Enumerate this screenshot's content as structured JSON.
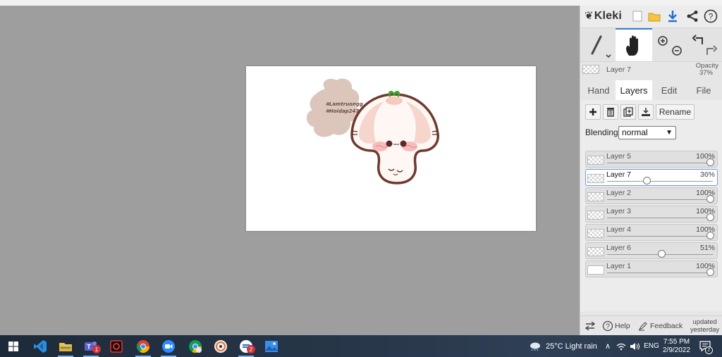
{
  "app": {
    "name": "Kleki"
  },
  "canvas": {
    "hashtags": [
      "#Lamtruongg",
      "#Hoidap247"
    ]
  },
  "current_layer": {
    "name": "Layer 7",
    "opacity_label": "Opacity",
    "opacity_value": "37%"
  },
  "tabs": [
    {
      "label": "Hand",
      "selected": false
    },
    {
      "label": "Layers",
      "selected": true
    },
    {
      "label": "Edit",
      "selected": false
    },
    {
      "label": "File",
      "selected": false
    }
  ],
  "layer_panel": {
    "add_icon": "plus-icon",
    "delete_icon": "trash-icon",
    "duplicate_icon": "duplicate-icon",
    "merge_icon": "merge-down-icon",
    "rename_label": "Rename",
    "blending_label": "Blending",
    "blending_value": "normal"
  },
  "layers": [
    {
      "name": "Layer 5",
      "opacity": "100%",
      "opacity_fraction": 1.0,
      "selected": false
    },
    {
      "name": "Layer 7",
      "opacity": "36%",
      "opacity_fraction": 0.36,
      "selected": true
    },
    {
      "name": "Layer 2",
      "opacity": "100%",
      "opacity_fraction": 1.0,
      "selected": false
    },
    {
      "name": "Layer 3",
      "opacity": "100%",
      "opacity_fraction": 1.0,
      "selected": false
    },
    {
      "name": "Layer 4",
      "opacity": "100%",
      "opacity_fraction": 1.0,
      "selected": false
    },
    {
      "name": "Layer 6",
      "opacity": "51%",
      "opacity_fraction": 0.51,
      "selected": false
    },
    {
      "name": "Layer 1",
      "opacity": "100%",
      "opacity_fraction": 1.0,
      "selected": false
    }
  ],
  "footer": {
    "help_label": "Help",
    "feedback_label": "Feedback",
    "updated_line1": "updated",
    "updated_line2": "yesterday"
  },
  "taskbar": {
    "weather": "25°C  Light rain",
    "language": "ENG",
    "time": "7:55 PM",
    "date": "2/9/2022",
    "notification_count": "2",
    "teams_badge": "1",
    "app_badge": "2"
  },
  "colors": {
    "accent": "#3a7bd5",
    "workspace": "#9e9e9e",
    "sidebar": "#e6e6e6",
    "taskbar": "#263548"
  }
}
